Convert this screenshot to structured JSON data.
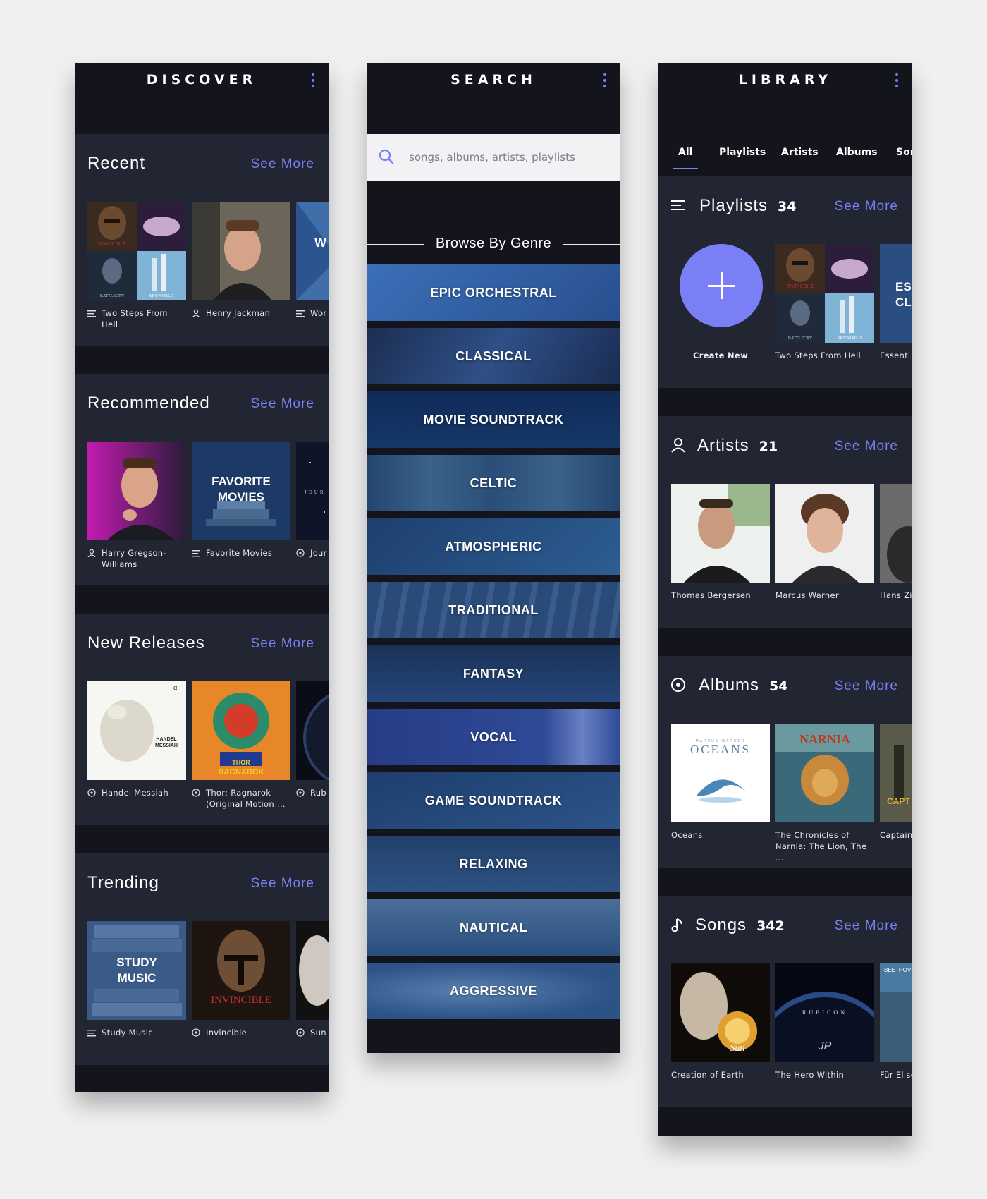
{
  "discover": {
    "title": "DISCOVER",
    "sections": [
      {
        "title": "Recent",
        "see_more": "See More",
        "items": [
          {
            "label": "Two Steps From Hell",
            "icon": "playlist-icon"
          },
          {
            "label": "Henry Jackman",
            "icon": "artist-icon"
          },
          {
            "label": "Wor",
            "icon": "playlist-icon",
            "art_text": "W"
          }
        ]
      },
      {
        "title": "Recommended",
        "see_more": "See More",
        "items": [
          {
            "label": "Harry Gregson-Williams",
            "icon": "artist-icon"
          },
          {
            "label": "Favorite Movies",
            "icon": "playlist-icon",
            "art_text": "FAVORITE MOVIES"
          },
          {
            "label": "Jour",
            "icon": "album-icon",
            "art_text": "JOUR"
          }
        ]
      },
      {
        "title": "New Releases",
        "see_more": "See More",
        "items": [
          {
            "label": "Handel Messiah",
            "icon": "album-icon",
            "art_text": "HANDEL MESSIAH"
          },
          {
            "label": "Thor: Ragnarok (Original Motion ...",
            "icon": "album-icon",
            "art_text": "THOR RAGNAROK"
          },
          {
            "label": "Rub",
            "icon": "album-icon"
          }
        ]
      },
      {
        "title": "Trending",
        "see_more": "See More",
        "items": [
          {
            "label": "Study Music",
            "icon": "playlist-icon",
            "art_text": "STUDY MUSIC"
          },
          {
            "label": "Invincible",
            "icon": "album-icon",
            "art_text": "INVINCIBLE"
          },
          {
            "label": "Sun",
            "icon": "album-icon"
          }
        ]
      }
    ],
    "art_small_texts": {
      "invincible": "INVINCIBLE",
      "battlecry": "BATTLECRY",
      "skyworld": "SKYWORLD"
    }
  },
  "search": {
    "title": "SEARCH",
    "placeholder": "songs, albums, artists, playlists",
    "browse_title": "Browse By Genre",
    "genres": [
      "EPIC ORCHESTRAL",
      "CLASSICAL",
      "MOVIE SOUNDTRACK",
      "CELTIC",
      "ATMOSPHERIC",
      "TRADITIONAL",
      "FANTASY",
      "VOCAL",
      "GAME SOUNDTRACK",
      "RELAXING",
      "NAUTICAL",
      "AGGRESSIVE"
    ]
  },
  "library": {
    "title": "LIBRARY",
    "tabs": [
      "All",
      "Playlists",
      "Artists",
      "Albums",
      "Son"
    ],
    "sections": [
      {
        "title": "Playlists",
        "count": "34",
        "see_more": "See More",
        "icon": "list-icon",
        "items": [
          {
            "label": "Create New"
          },
          {
            "label": "Two Steps From Hell"
          },
          {
            "label": "Essenti",
            "art_text": "ES CL"
          }
        ]
      },
      {
        "title": "Artists",
        "count": "21",
        "see_more": "See More",
        "icon": "person-icon",
        "items": [
          {
            "label": "Thomas Bergersen"
          },
          {
            "label": "Marcus Warner"
          },
          {
            "label": "Hans Zi"
          }
        ]
      },
      {
        "title": "Albums",
        "count": "54",
        "see_more": "See More",
        "icon": "disc-icon",
        "items": [
          {
            "label": "Oceans",
            "art_text": "OCEANS",
            "art_sub": "MARCUS WARNER"
          },
          {
            "label": "The Chronicles of Narnia: The Lion, The ...",
            "art_text": "NARNIA"
          },
          {
            "label": "Captain The Wir",
            "art_text": "CAPT"
          }
        ]
      },
      {
        "title": "Songs",
        "count": "342",
        "see_more": "See More",
        "icon": "note-icon",
        "items": [
          {
            "label": "Creation of Earth",
            "art_text": "Sun"
          },
          {
            "label": "The Hero Within",
            "art_text": "RUBICON"
          },
          {
            "label": "Für Elise",
            "art_text": "BEETHOV"
          }
        ]
      }
    ]
  },
  "colors": {
    "accent": "#7b7ff5",
    "background": "#13141c",
    "panel": "#222532",
    "page": "#f0f0f1"
  }
}
